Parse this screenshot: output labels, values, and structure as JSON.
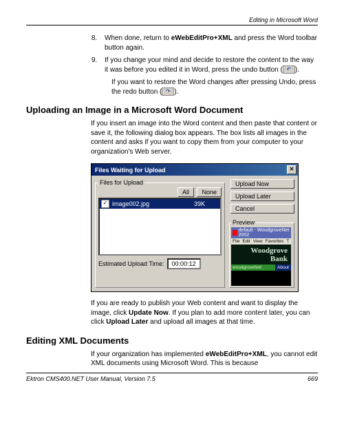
{
  "header": {
    "running_title": "Editing in Microsoft Word"
  },
  "list": {
    "item8": "When done, return to <b>eWebEditPro+XML</b> and press the Word toolbar button again.",
    "item9_a": "If you change your mind and decide to restore the content to the way it was before you edited it in Word, press the undo button (",
    "item9_b": ").",
    "item9_follow_a": "If you want to restore the Word changes after pressing Undo, press the redo button (",
    "item9_follow_b": ")."
  },
  "section1": {
    "heading": "Uploading an Image in a Microsoft Word Document",
    "para": "If you insert an image into the Word content and then paste that content or save it, the following dialog box appears. The box lists all images in the content and asks if you want to copy them from your computer to your organization's Web server."
  },
  "dialog": {
    "title": "Files Waiting for Upload",
    "files_legend": "Files for Upload",
    "all_btn": "All",
    "none_btn": "None",
    "filename": "image002.jpg",
    "filesize": "39K",
    "time_label": "Estimated Upload Time:",
    "time_value": "00:00:12",
    "upload_now": "Upload Now",
    "upload_later": "Upload Later",
    "cancel": "Cancel",
    "preview_legend": "Preview",
    "preview_title": "default - WoodgroveNet 2002",
    "preview_menu": {
      "file": "File",
      "edit": "Edit",
      "view": "View",
      "fav": "Favorites",
      "t": "T"
    },
    "banner1": "Woodgrove",
    "banner2": "Bank",
    "nav1": "woodgroveNet",
    "nav2": "About"
  },
  "section1_after": "If you are ready to publish your Web content and want to display the image, click <b>Update Now</b>. If you plan to add more content later, you can click <b>Upload Later</b> and upload all images at that time.",
  "section2": {
    "heading": "Editing XML Documents",
    "para": "If your organization has implemented <b>eWebEditPro+XML</b>, you cannot edit XML documents using Microsoft Word. This is because"
  },
  "footer": {
    "left": "Ektron CMS400.NET User Manual, Version 7.5",
    "right": "669"
  }
}
